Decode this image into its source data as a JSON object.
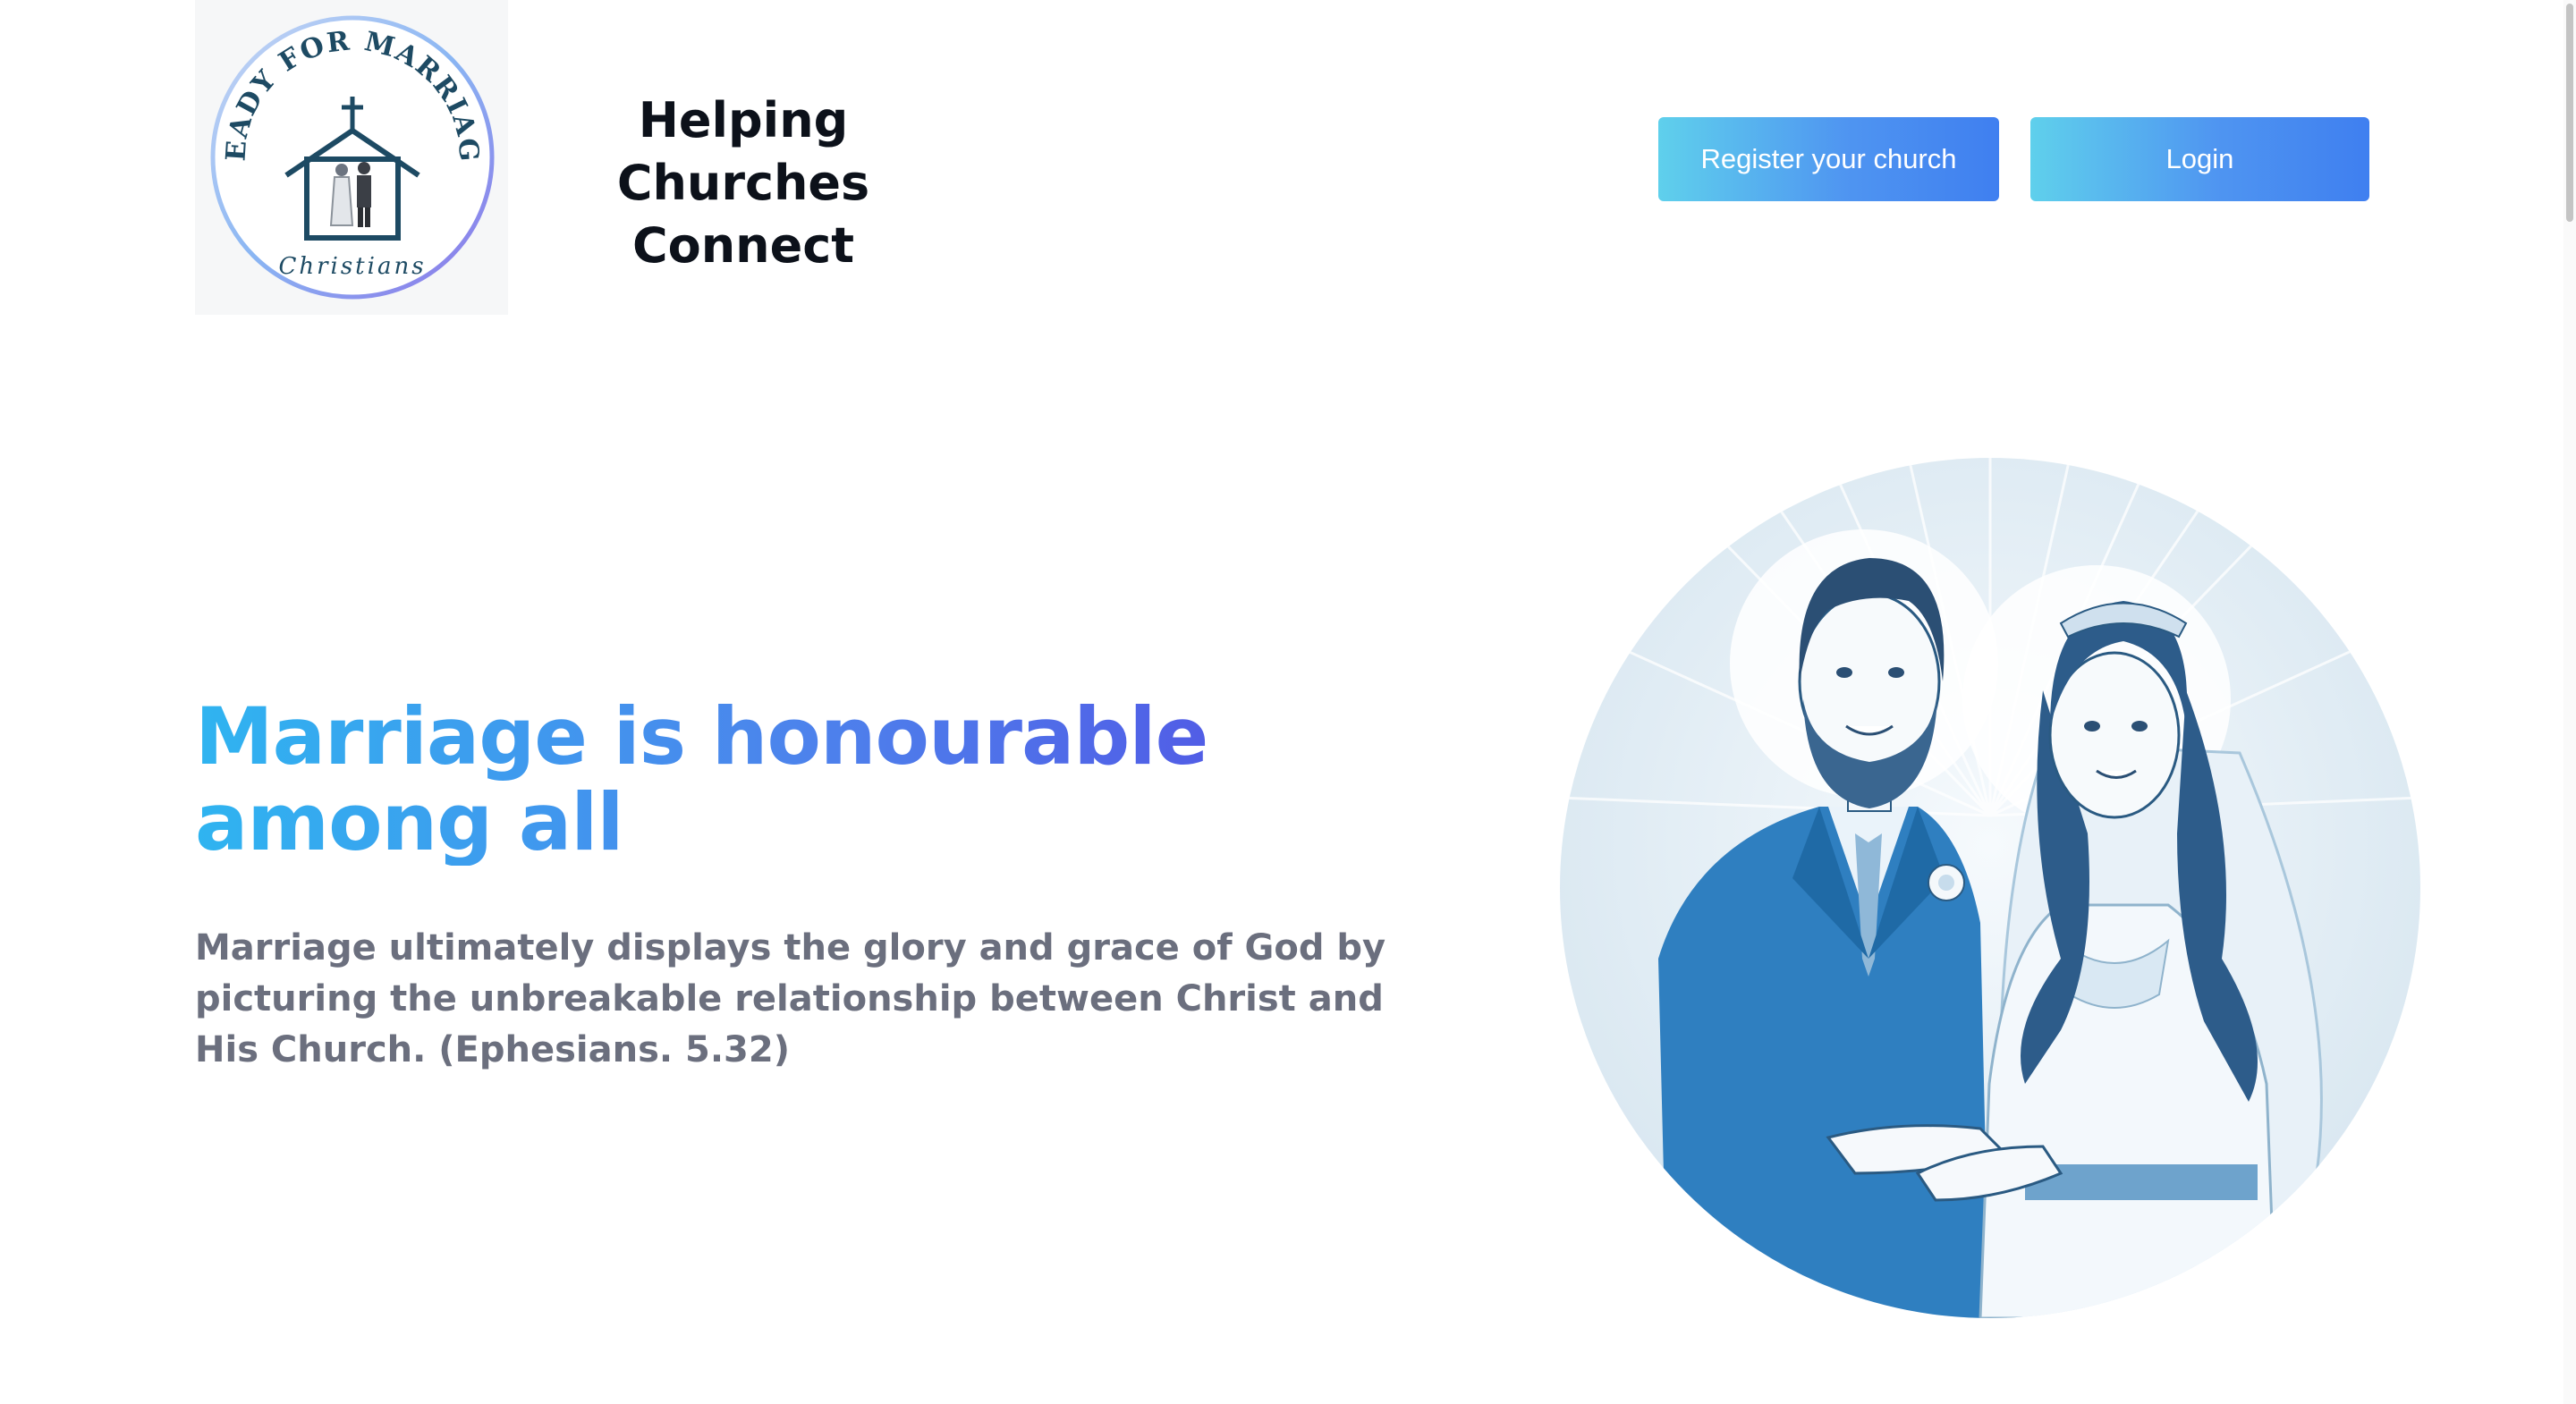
{
  "brand": {
    "logo_arc_text": "READY FOR MARRIAGE",
    "logo_sub_text": "Christians",
    "tagline_line1": "Helping",
    "tagline_line2": "Churches Connect"
  },
  "nav": {
    "register_label": "Register your church",
    "login_label": "Login"
  },
  "hero": {
    "title": "Marriage is honourable among all",
    "description": "Marriage ultimately displays the glory and grace of God by picturing the unbreakable relationship between Christ and His Church. (Ephesians. 5.32)",
    "image_icon": "bride-and-groom-illustration"
  },
  "colors": {
    "button_gradient_start": "#5fd0ec",
    "button_gradient_end": "#3f7ff0",
    "title_gradient_start": "#2fb4f0",
    "title_gradient_end": "#5444e2",
    "body_text": "#6b6f7e",
    "logo_text": "#1d4a63"
  }
}
